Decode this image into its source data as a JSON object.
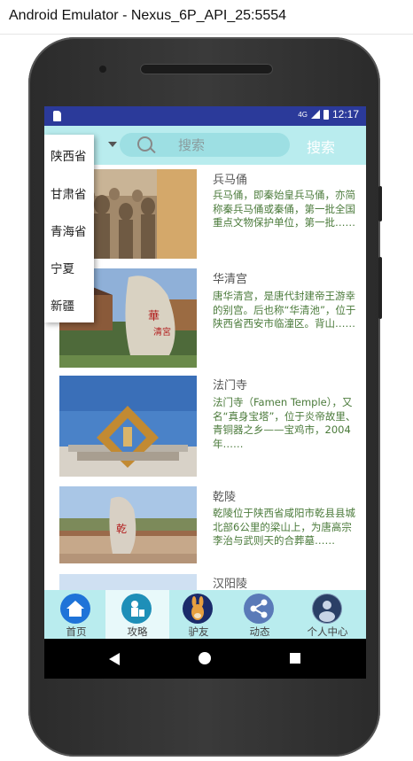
{
  "window": {
    "title": "Android Emulator - Nexus_6P_API_25:5554"
  },
  "status_bar": {
    "network": "4G",
    "time": "12:17"
  },
  "search": {
    "placeholder": "搜索",
    "button_label": "搜索"
  },
  "province_dropdown": {
    "options": [
      "陕西省",
      "甘肃省",
      "青海省",
      "宁夏",
      "新疆"
    ]
  },
  "attractions": [
    {
      "title": "兵马俑",
      "description": "兵马俑，即秦始皇兵马俑，亦简称秦兵马俑或秦俑，第一批全国重点文物保护单位，第一批……"
    },
    {
      "title": "华清宫",
      "description": "唐华清宫，是唐代封建帝王游幸的别宫。后也称“华清池”，位于陕西省西安市临潼区。背山……"
    },
    {
      "title": "法门寺",
      "description": "法门寺（Famen Temple），又名“真身宝塔”，位于炎帝故里、青铜器之乡——宝鸡市，2004年……"
    },
    {
      "title": "乾陵",
      "description": "乾陵位于陕西省咸阳市乾县县城北部6公里的梁山上，为唐高宗李治与武则天的合葬墓……"
    },
    {
      "title": "汉阳陵",
      "description": ""
    }
  ],
  "bottom_nav": {
    "items": [
      {
        "label": "首页",
        "icon": "home-icon"
      },
      {
        "label": "攻略",
        "icon": "guide-icon"
      },
      {
        "label": "驴友",
        "icon": "donkey-icon"
      },
      {
        "label": "动态",
        "icon": "share-icon"
      },
      {
        "label": "个人中心",
        "icon": "user-icon"
      }
    ],
    "active_index": 1
  },
  "colors": {
    "status_bar": "#2b3a9a",
    "accent": "#b9ecee",
    "description_text": "#4a7a3a"
  }
}
